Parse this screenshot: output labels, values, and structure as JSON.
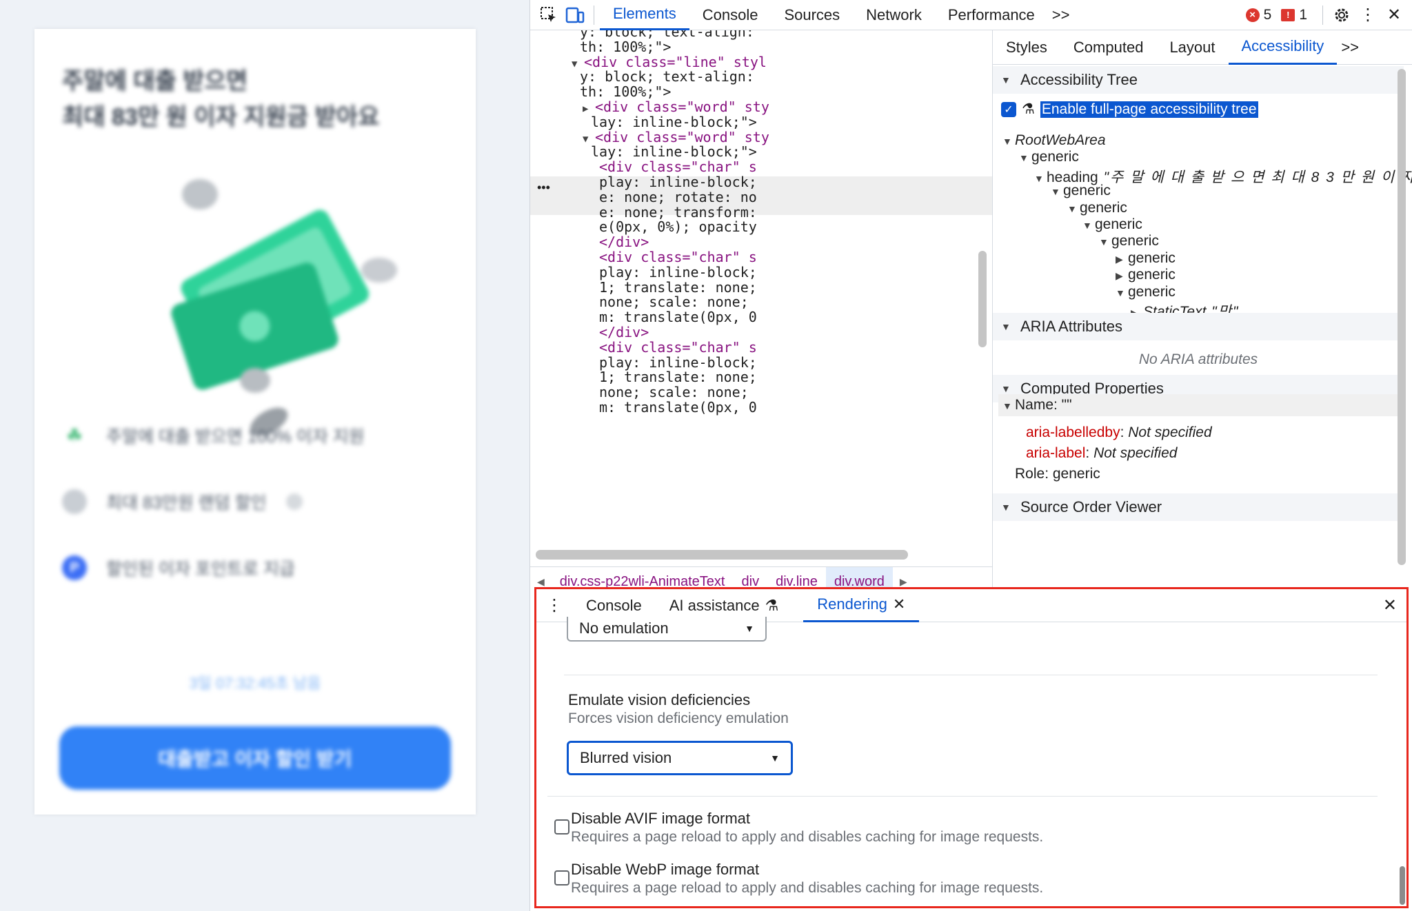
{
  "page": {
    "hero_line1": "주말에 대출 받으면",
    "hero_line2": "최대 83만 원 이자 지원금 받아요",
    "benefits": [
      "주말에 대출 받으면 100% 이자 지원",
      "최대 83만원 랜덤 할인",
      "할인된 이자 포인트로 지급"
    ],
    "timer": "3일 07:32:45초 남음",
    "cta": "대출받고 이자 할인 받기"
  },
  "toolbar": {
    "tabs": [
      "Elements",
      "Console",
      "Sources",
      "Network",
      "Performance"
    ],
    "more": ">>",
    "errors": "5",
    "issues": "1"
  },
  "elements": {
    "lines": [
      {
        "t": "y: block; text-align:"
      },
      {
        "t": "th: 100%;\">"
      },
      {
        "t": "<div class=\"line\" styl"
      },
      {
        "t": "y: block; text-align:"
      },
      {
        "t": "th: 100%;\">"
      },
      {
        "t": "<div class=\"word\" sty"
      },
      {
        "t": "lay: inline-block;\">"
      },
      {
        "t": "<div class=\"word\" sty"
      },
      {
        "t": "lay: inline-block;\">"
      },
      {
        "t": "<div class=\"char\" s"
      },
      {
        "t": "play: inline-block;"
      },
      {
        "t": "e: none; rotate: no"
      },
      {
        "t": "e: none; transform:"
      },
      {
        "t": "e(0px, 0%); opacity"
      },
      {
        "t": "</div>"
      },
      {
        "t": "<div class=\"char\" s"
      },
      {
        "t": "play: inline-block;"
      },
      {
        "t": "1; translate: none;"
      },
      {
        "t": "none; scale: none;"
      },
      {
        "t": "m: translate(0px, 0"
      },
      {
        "t": "</div>"
      },
      {
        "t": "<div class=\"char\" s"
      },
      {
        "t": "play: inline-block;"
      },
      {
        "t": "1; translate: none;"
      },
      {
        "t": "none; scale: none;"
      },
      {
        "t": "m: translate(0px, 0"
      }
    ],
    "breadcrumbs": [
      "div.css-p22wli-AnimateText",
      "div",
      "div.line",
      "div.word"
    ]
  },
  "sidebar": {
    "tabs": [
      "Styles",
      "Computed",
      "Layout",
      "Accessibility"
    ],
    "more": ">>",
    "sec_tree": "Accessibility Tree",
    "enable_full": "Enable full-page accessibility tree",
    "tree": [
      {
        "role": "RootWebArea",
        "name": ""
      },
      {
        "role": "generic",
        "name": ""
      },
      {
        "role": "heading",
        "name": "\"주 말 에 대 출 받 으 면 최 대 8 3 만 원 이 자"
      },
      {
        "role": "generic",
        "name": ""
      },
      {
        "role": "generic",
        "name": ""
      },
      {
        "role": "generic",
        "name": ""
      },
      {
        "role": "generic",
        "name": ""
      },
      {
        "role": "generic",
        "name": ""
      },
      {
        "role": "generic",
        "name": ""
      },
      {
        "role": "generic",
        "name": ""
      },
      {
        "role": "StaticText",
        "name": "\"만\""
      }
    ],
    "sec_aria": "ARIA Attributes",
    "no_aria": "No ARIA attributes",
    "sec_computed": "Computed Properties",
    "name_label": "Name: \"\"",
    "labelledby_key": "aria-labelledby",
    "labelledby_val": "Not specified",
    "label_key": "aria-label",
    "label_val": "Not specified",
    "role": "Role: generic",
    "sec_source": "Source Order Viewer"
  },
  "drawer": {
    "tabs": [
      "Console",
      "AI assistance",
      "Rendering"
    ],
    "media_select": "No emulation",
    "vision_title": "Emulate vision deficiencies",
    "vision_sub": "Forces vision deficiency emulation",
    "vision_select": "Blurred vision",
    "avif_title": "Disable AVIF image format",
    "avif_sub": "Requires a page reload to apply and disables caching for image requests.",
    "webp_title": "Disable WebP image format",
    "webp_sub": "Requires a page reload to apply and disables caching for image requests."
  },
  "colors": {
    "accent": "#0b57d0",
    "highlight_border": "#e8271d",
    "cta": "#3182f6"
  }
}
